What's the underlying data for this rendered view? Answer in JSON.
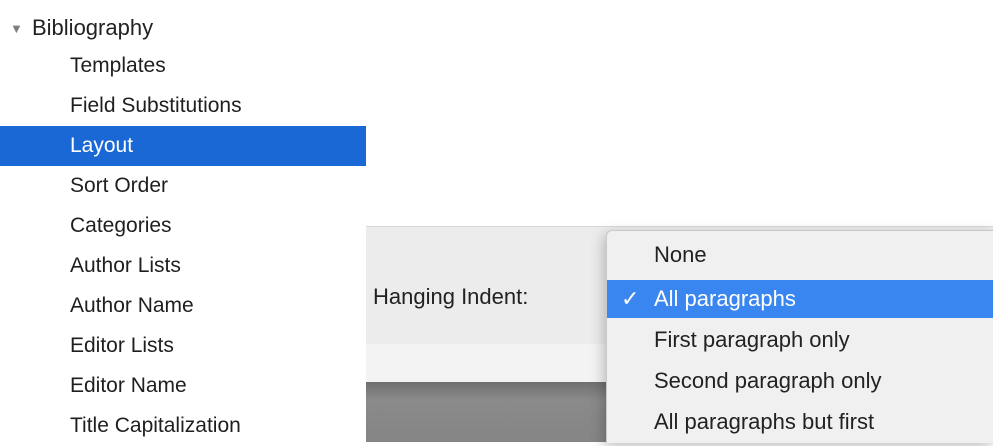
{
  "sidebar": {
    "group_label": "Bibliography",
    "disclosure": "▼",
    "items": [
      {
        "label": "Templates"
      },
      {
        "label": "Field Substitutions"
      },
      {
        "label": "Layout"
      },
      {
        "label": "Sort Order"
      },
      {
        "label": "Categories"
      },
      {
        "label": "Author Lists"
      },
      {
        "label": "Author Name"
      },
      {
        "label": "Editor Lists"
      },
      {
        "label": "Editor Name"
      },
      {
        "label": "Title Capitalization"
      }
    ],
    "selected": "Layout"
  },
  "panel": {
    "hanging_indent_label": "Hanging Indent:"
  },
  "popup": {
    "selected": "All paragraphs",
    "check_mark": "✓",
    "options": [
      {
        "label": "None"
      },
      {
        "label": "All paragraphs"
      },
      {
        "label": "First paragraph only"
      },
      {
        "label": "Second paragraph only"
      },
      {
        "label": "All paragraphs but first"
      }
    ]
  },
  "colors": {
    "selection": "#1a68d6",
    "menu_highlight": "#3a86f0"
  }
}
